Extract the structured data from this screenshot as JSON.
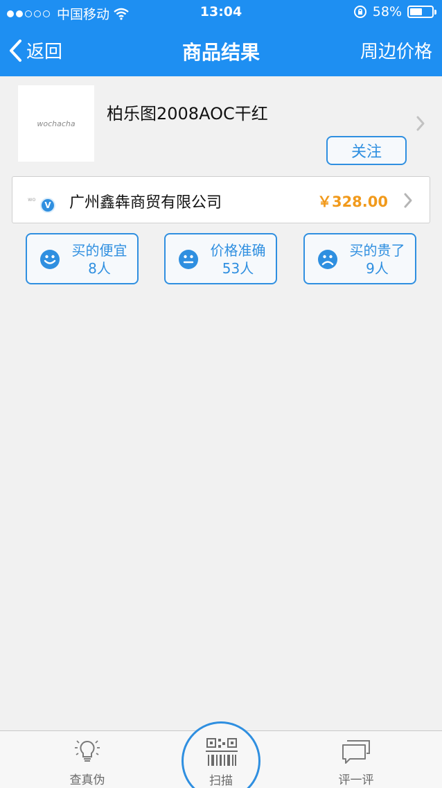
{
  "status_bar": {
    "carrier": "中国移动",
    "time": "13:04",
    "battery": "58%",
    "battery_level": 0.58
  },
  "nav": {
    "back_label": "返回",
    "title": "商品结果",
    "right_label": "周边价格"
  },
  "product": {
    "name": "柏乐图2008AOC干红",
    "thumb_text": "wochacha",
    "follow_label": "关注"
  },
  "store": {
    "name": "广州鑫犇商贸有限公司",
    "price": "￥328.00",
    "verified_badge": "V"
  },
  "ratings": [
    {
      "label": "买的便宜",
      "count": "8人",
      "icon": "smile-face-icon"
    },
    {
      "label": "价格准确",
      "count": "53人",
      "icon": "neutral-face-icon"
    },
    {
      "label": "买的贵了",
      "count": "9人",
      "icon": "sad-face-icon"
    }
  ],
  "tabbar": {
    "left": {
      "label": "查真伪",
      "icon": "lightbulb-icon"
    },
    "center": {
      "label": "扫描",
      "icon": "qr-barcode-icon"
    },
    "right": {
      "label": "评一评",
      "icon": "chat-bubbles-icon"
    }
  },
  "colors": {
    "primary": "#1e8ff2",
    "accent_blue": "#2f8fe0",
    "price_orange": "#f19a1c",
    "background": "#f1f1f1"
  }
}
